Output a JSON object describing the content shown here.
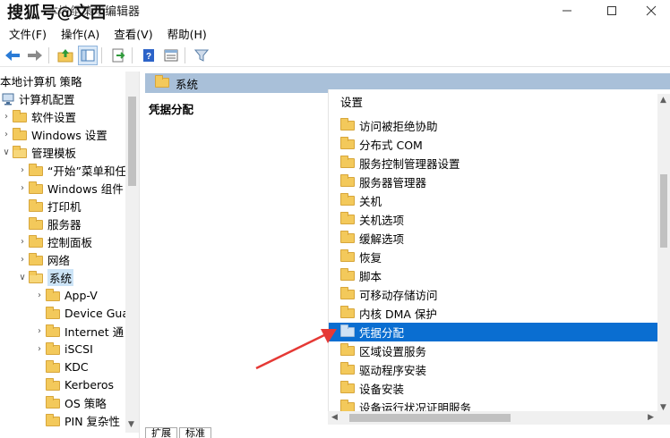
{
  "window": {
    "title": "本地组策略编辑器",
    "watermark": "搜狐号@文西",
    "minimize": "minimize",
    "maximize": "maximize",
    "close": "close"
  },
  "menu": [
    "文件(F)",
    "操作(A)",
    "查看(V)",
    "帮助(H)"
  ],
  "toolbar_icons": [
    "back-icon",
    "forward-icon",
    "up-folder-icon",
    "show-hide-tree-icon",
    "export-list-icon",
    "help-icon",
    "properties-icon",
    "filter-icon"
  ],
  "tree": {
    "items": [
      {
        "label": "本地计算机 策略",
        "level": 0,
        "twisty": "",
        "icon": "none"
      },
      {
        "label": "计算机配置",
        "level": 0,
        "twisty": "",
        "icon": "computer"
      },
      {
        "label": "软件设置",
        "level": 1,
        "twisty": ">",
        "icon": "folder"
      },
      {
        "label": "Windows 设置",
        "level": 1,
        "twisty": ">",
        "icon": "folder"
      },
      {
        "label": "管理模板",
        "level": 1,
        "twisty": "v",
        "icon": "folder"
      },
      {
        "label": "“开始”菜单和任",
        "level": 2,
        "twisty": ">",
        "icon": "folder"
      },
      {
        "label": "Windows 组件",
        "level": 2,
        "twisty": ">",
        "icon": "folder"
      },
      {
        "label": "打印机",
        "level": 2,
        "twisty": "",
        "icon": "folder"
      },
      {
        "label": "服务器",
        "level": 2,
        "twisty": "",
        "icon": "folder"
      },
      {
        "label": "控制面板",
        "level": 2,
        "twisty": ">",
        "icon": "folder"
      },
      {
        "label": "网络",
        "level": 2,
        "twisty": ">",
        "icon": "folder"
      },
      {
        "label": "系统",
        "level": 2,
        "twisty": "v",
        "icon": "folder-open"
      },
      {
        "label": "App-V",
        "level": 3,
        "twisty": ">",
        "icon": "folder"
      },
      {
        "label": "Device Gua",
        "level": 3,
        "twisty": "",
        "icon": "folder"
      },
      {
        "label": "Internet 通",
        "level": 3,
        "twisty": ">",
        "icon": "folder"
      },
      {
        "label": "iSCSI",
        "level": 3,
        "twisty": ">",
        "icon": "folder"
      },
      {
        "label": "KDC",
        "level": 3,
        "twisty": "",
        "icon": "folder"
      },
      {
        "label": "Kerberos",
        "level": 3,
        "twisty": "",
        "icon": "folder"
      },
      {
        "label": "OS 策略",
        "level": 3,
        "twisty": "",
        "icon": "folder"
      },
      {
        "label": "PIN 复杂性",
        "level": 3,
        "twisty": "",
        "icon": "folder"
      }
    ]
  },
  "right": {
    "header": "系统",
    "description_title": "凭据分配",
    "list_header": "设置",
    "items": [
      "访问被拒绝协助",
      "分布式 COM",
      "服务控制管理器设置",
      "服务器管理器",
      "关机",
      "关机选项",
      "缓解选项",
      "恢复",
      "脚本",
      "可移动存储访问",
      "内核 DMA 保护",
      "凭据分配",
      "区域设置服务",
      "驱动程序安装",
      "设备安装",
      "设备运行状况证明服务"
    ],
    "selected_item": "凭据分配"
  },
  "tabs": [
    "扩展",
    "标准"
  ],
  "colors": {
    "selection": "#0a6ed1",
    "header_bar": "#a9c0d9",
    "folder": "#f3c95b",
    "arrow": "#e53935"
  }
}
